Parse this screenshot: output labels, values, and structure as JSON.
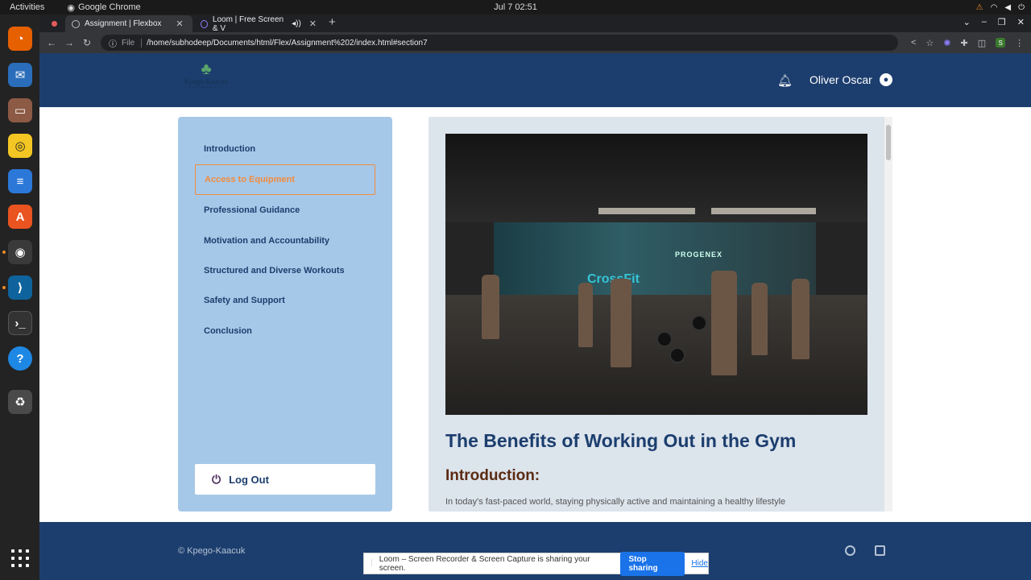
{
  "os_bar": {
    "activities": "Activities",
    "app_name": "Google Chrome",
    "clock": "Jul 7  02:51"
  },
  "browser": {
    "tabs": [
      {
        "title": "Assignment | Flexbox"
      },
      {
        "title": "Loom | Free Screen & V"
      }
    ],
    "address_prefix": "File",
    "url": "/home/subhodeep/Documents/html/Flex/Assignment%202/index.html#section7"
  },
  "site": {
    "brand": "Kpego-Kaacuk",
    "username": "Oliver Oscar",
    "nav": [
      {
        "label": "Introduction",
        "active": false
      },
      {
        "label": "Access to Equipment",
        "active": true
      },
      {
        "label": "Professional Guidance",
        "active": false
      },
      {
        "label": "Motivation and Accountability",
        "active": false
      },
      {
        "label": "Structured and Diverse Workouts",
        "active": false
      },
      {
        "label": "Safety and Support",
        "active": false
      },
      {
        "label": "Conclusion",
        "active": false
      }
    ],
    "logout_label": "Log Out",
    "article": {
      "hero_signs": [
        "PROGENEX",
        "CrossFit"
      ],
      "title": "The Benefits of Working Out in the Gym",
      "section_heading": "Introduction:",
      "text": "In today's fast-paced world, staying physically active and maintaining a healthy lifestyle"
    },
    "footer": {
      "copyright": "© Kpego-Kaacuk"
    }
  },
  "share_bar": {
    "message": "Loom – Screen Recorder & Screen Capture is sharing your screen.",
    "stop_label": "Stop sharing",
    "hide_label": "Hide"
  },
  "colors": {
    "header_bg": "#1c3e6e",
    "sidebar_bg": "#a6c8e8",
    "active_accent": "#f28b3c"
  }
}
